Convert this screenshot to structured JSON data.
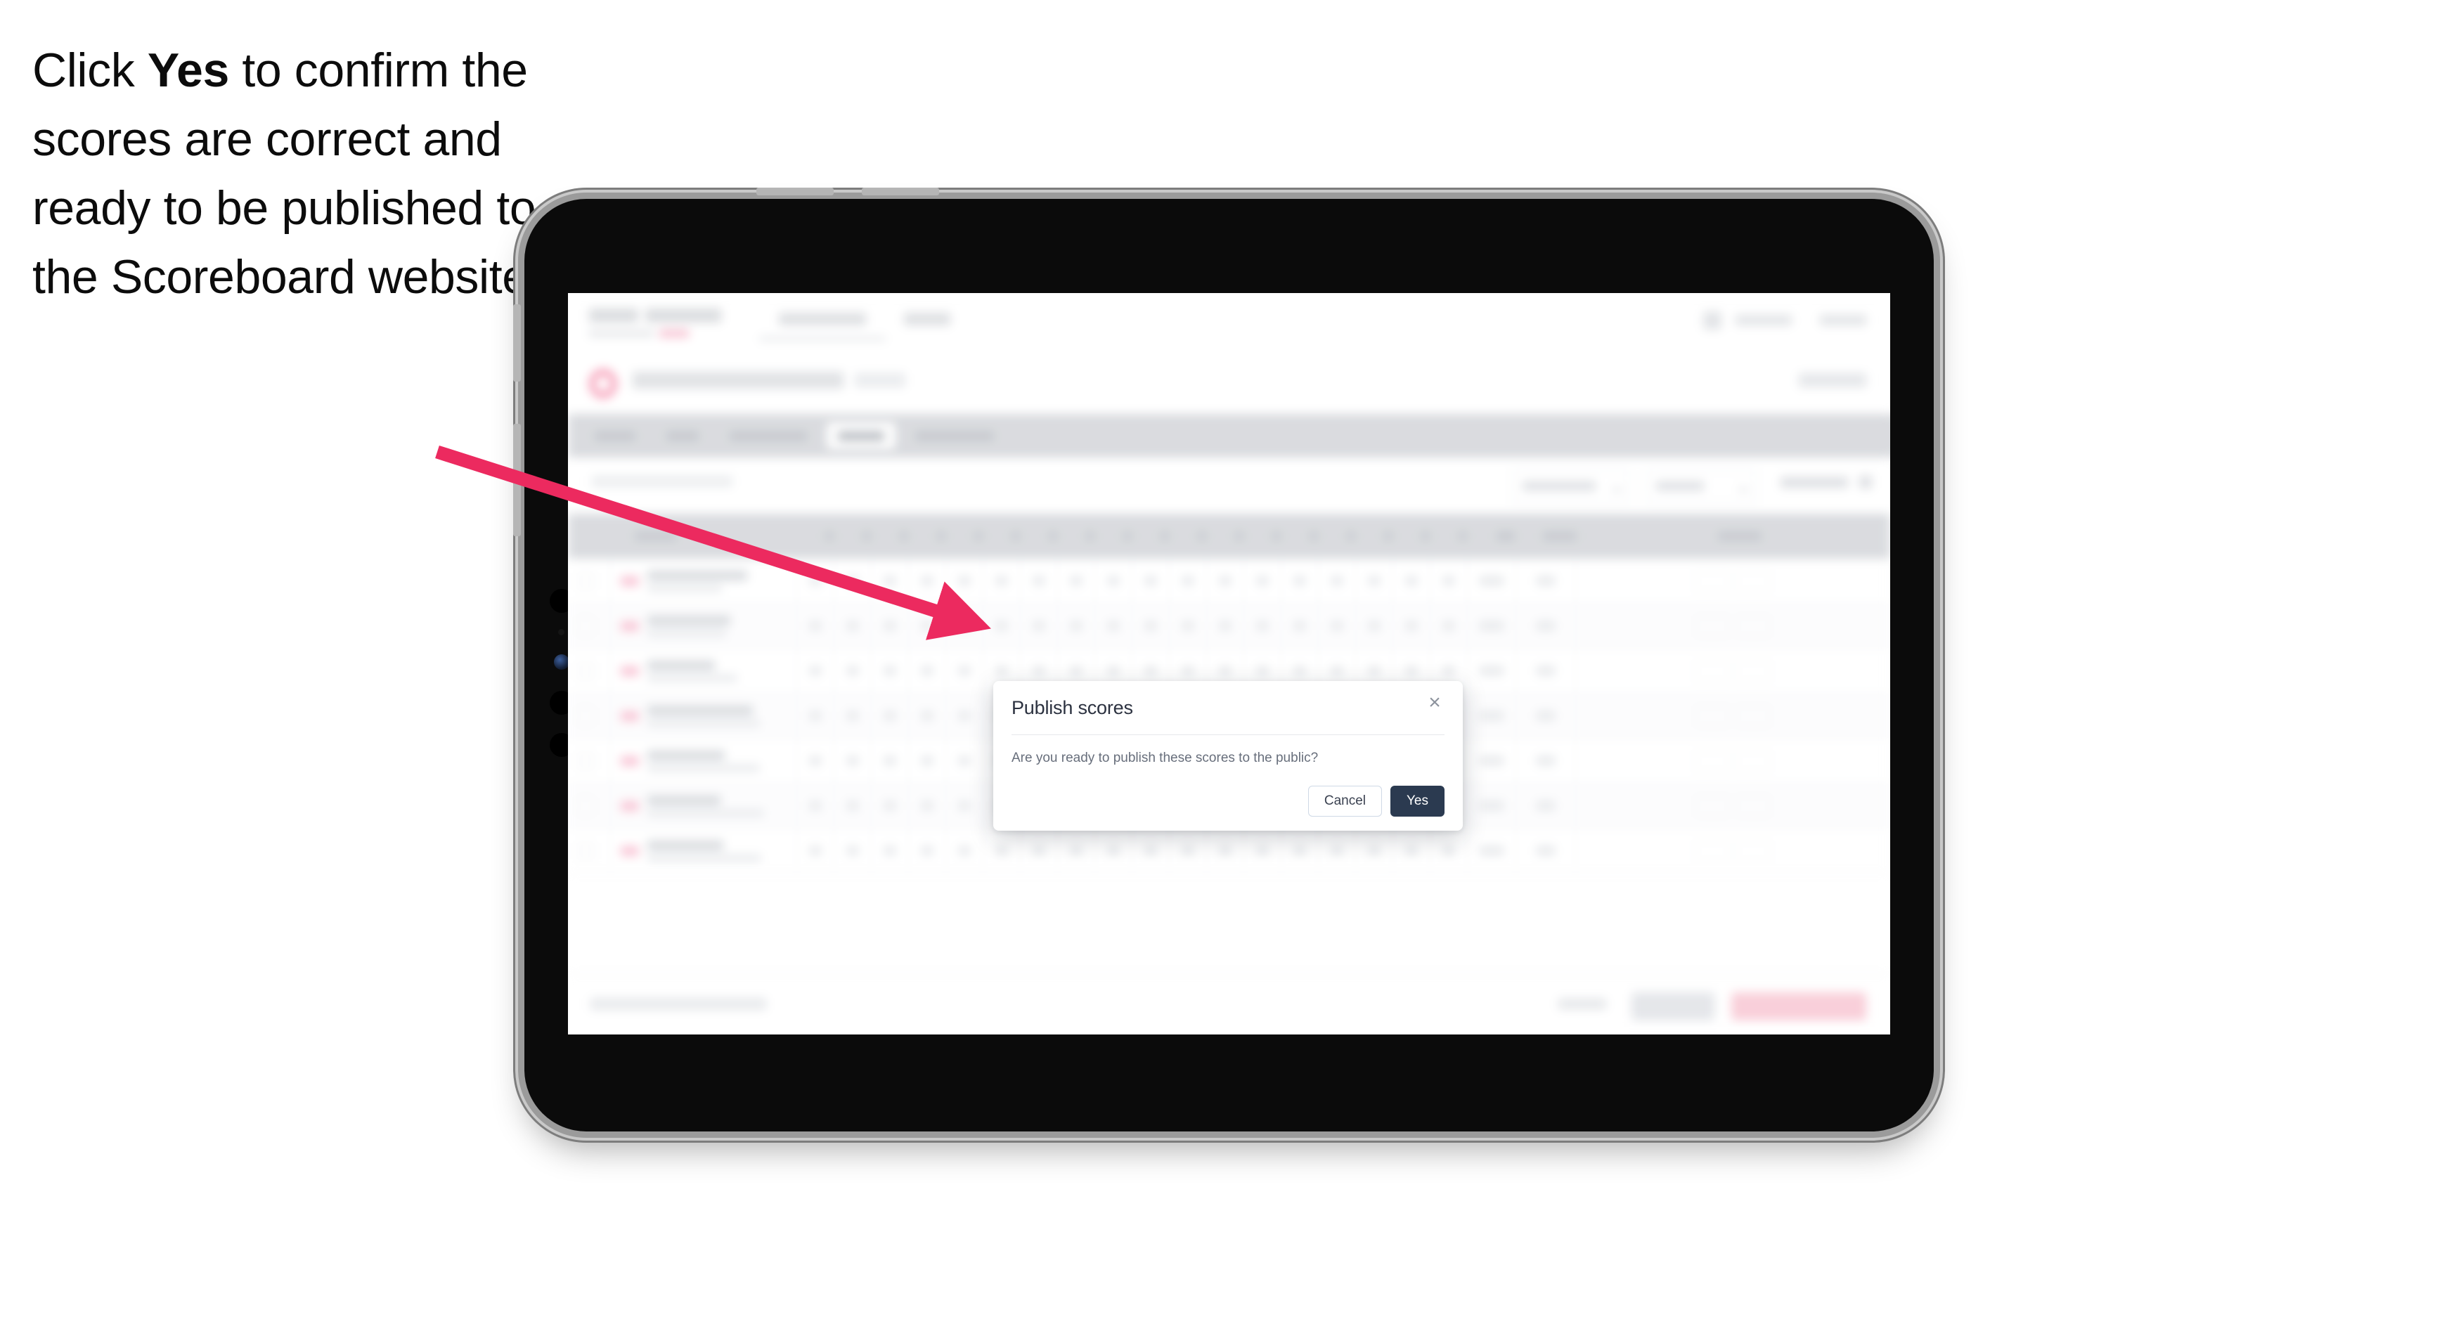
{
  "instruction": {
    "before": "Click ",
    "emphasis": "Yes",
    "after": " to confirm the scores are correct and ready to be published to the Scoreboard website."
  },
  "device": {
    "type": "tablet",
    "orientation": "landscape"
  },
  "modal": {
    "title": "Publish scores",
    "body": "Are you ready to publish these scores to the public?",
    "close_icon": "×",
    "cancel_label": "Cancel",
    "confirm_label": "Yes",
    "confirm_color": "#2b3a50",
    "cancel_border_color": "#cfd9e6"
  },
  "annotation": {
    "arrow_color": "#ec2a5f",
    "points_to": "modal"
  },
  "background_app": {
    "blurred": true,
    "note": "Application behind the modal is rendered out of focus; its text is not legible in the screenshot.",
    "nav": {
      "links_count": 2,
      "right_items_count": 2
    },
    "tabs": {
      "count": 5,
      "active_index": 3
    },
    "filters": {
      "selects_count": 2,
      "text_items_count": 1
    },
    "table": {
      "row_count": 7,
      "score_column_count": 17,
      "summary_column_count": 2,
      "action_column_count": 1
    },
    "footer": {
      "link_count": 1,
      "secondary_button_color": "#e3e5e9",
      "primary_button_color": "#f9ccd7"
    },
    "accent_color": "#f04678"
  }
}
